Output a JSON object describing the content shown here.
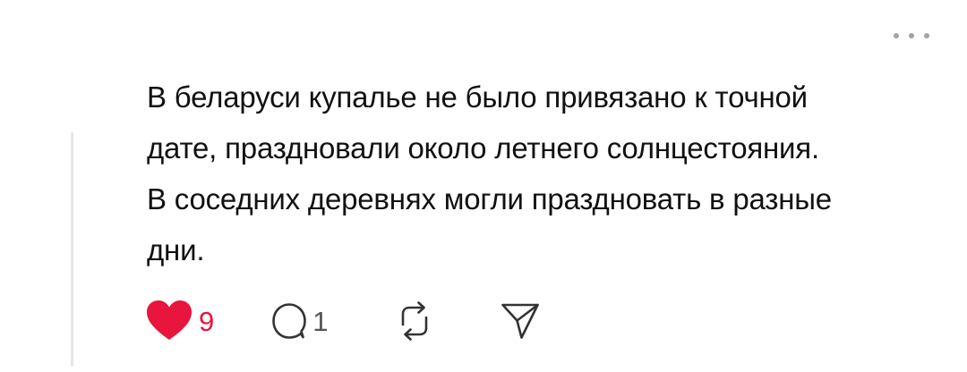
{
  "post": {
    "text": "В беларуси купалье не было привязано к точной\nдате, праздновали около летнего солнцестояния.\nВ соседних деревнях могли праздновать в разные\nдни."
  },
  "actions": {
    "likes": {
      "count": "9",
      "icon": "heart-filled-icon",
      "color": "#e8153c",
      "liked": true
    },
    "replies": {
      "count": "1",
      "icon": "comment-icon"
    },
    "repost": {
      "icon": "repost-icon"
    },
    "share": {
      "icon": "send-icon"
    }
  },
  "menu": {
    "icon": "more-horizontal-icon"
  }
}
